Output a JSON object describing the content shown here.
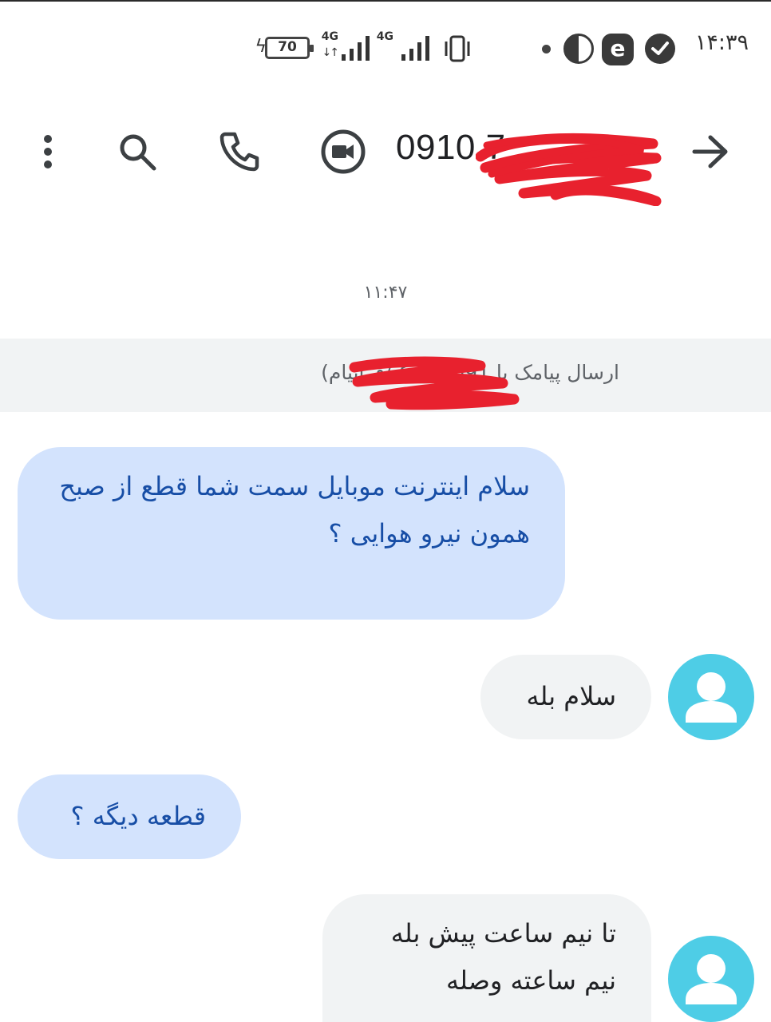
{
  "status_bar": {
    "time": "۱۴:۳۹",
    "battery_level": "70",
    "network_1": "4G",
    "network_2": "4G",
    "icons": [
      "check-badge-icon",
      "e-app-icon",
      "yin-yang-app-icon",
      "notification-dot-icon",
      "vibrate-icon",
      "signal-icon",
      "signal-icon",
      "battery-icon",
      "charging-icon"
    ]
  },
  "app_bar": {
    "contact_number": "0910 7",
    "icons": [
      "more-vert-icon",
      "search-icon",
      "phone-icon",
      "video-call-icon",
      "arrow-icon"
    ]
  },
  "conversation": {
    "timestamp": "۱۱:۴۷",
    "send_banner": "ارسال پیامک با 091 (پیامک/فراپیام)",
    "messages": [
      {
        "direction": "incoming",
        "text": "سلام اینترنت موبایل سمت شما قطع از صبح\nهمون نیرو هوایی ؟"
      },
      {
        "direction": "outgoing",
        "text": "سلام بله"
      },
      {
        "direction": "incoming",
        "text": "قطعه دیگه ؟"
      },
      {
        "direction": "outgoing",
        "text": "تا نیم ساعت پیش بله\nنیم ساعته وصله"
      }
    ]
  },
  "colors": {
    "incoming_bubble": "#d3e3fd",
    "incoming_text": "#174ea6",
    "outgoing_bubble": "#f1f3f4",
    "avatar": "#4ecde6",
    "redaction": "#e8212e"
  }
}
